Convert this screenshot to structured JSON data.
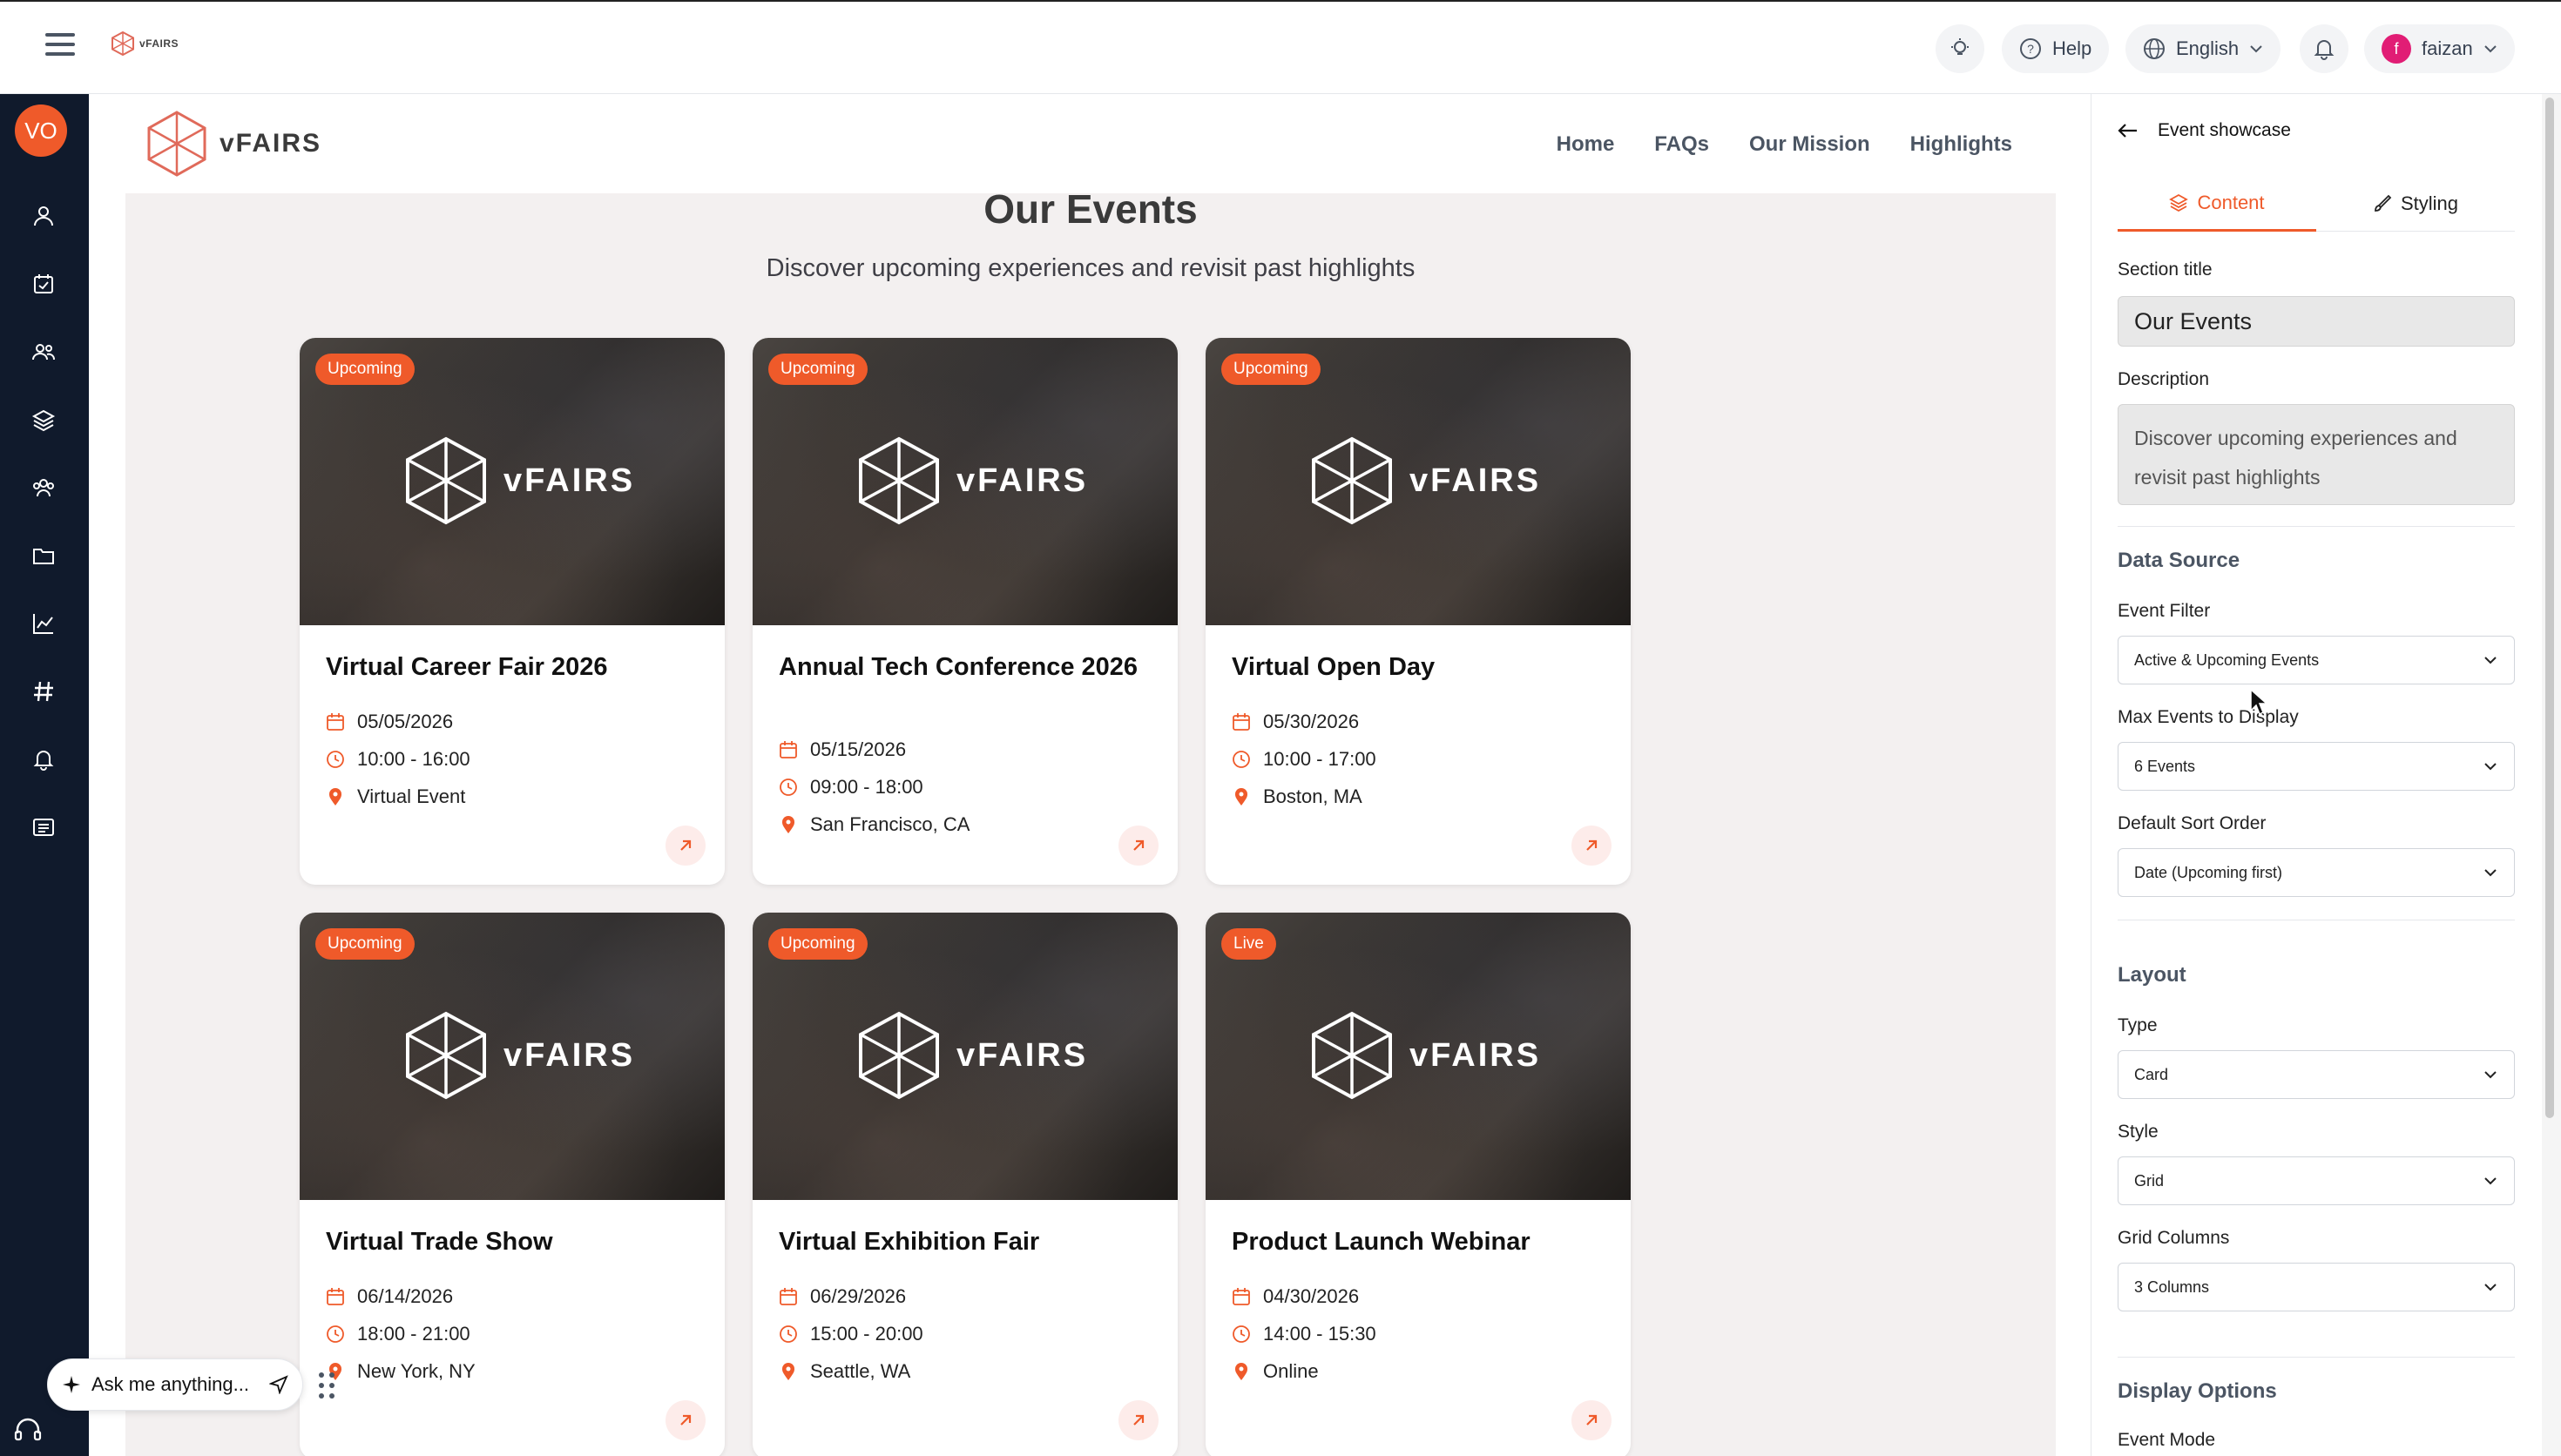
{
  "topbar": {
    "logo_text": "vFAIRS",
    "help_label": "Help",
    "language_label": "English",
    "user_initial": "f",
    "user_name": "faizan"
  },
  "rail": {
    "avatar_initials": "VO",
    "items": [
      "user-icon",
      "calendar-check-icon",
      "users-icon",
      "layers-icon",
      "team-icon",
      "folder-icon",
      "analytics-icon",
      "hashtag-icon",
      "bell-icon",
      "list-icon"
    ]
  },
  "site": {
    "logo_text": "vFAIRS",
    "nav": [
      "Home",
      "FAQs",
      "Our Mission",
      "Highlights"
    ]
  },
  "section": {
    "title": "Our Events",
    "description": "Discover upcoming experiences and revisit past highlights"
  },
  "events": [
    {
      "badge": "Upcoming",
      "brand": "vFAIRS",
      "title": "Virtual Career Fair 2026",
      "date": "05/05/2026",
      "time": "10:00 - 16:00",
      "location": "Virtual Event"
    },
    {
      "badge": "Upcoming",
      "brand": "vFAIRS",
      "title": "Annual Tech Conference 2026",
      "date": "05/15/2026",
      "time": "09:00 - 18:00",
      "location": "San Francisco, CA"
    },
    {
      "badge": "Upcoming",
      "brand": "vFAIRS",
      "title": "Virtual Open Day",
      "date": "05/30/2026",
      "time": "10:00 - 17:00",
      "location": "Boston, MA"
    },
    {
      "badge": "Upcoming",
      "brand": "vFAIRS",
      "title": "Virtual Trade Show",
      "date": "06/14/2026",
      "time": "18:00 - 21:00",
      "location": "New York, NY"
    },
    {
      "badge": "Upcoming",
      "brand": "vFAIRS",
      "title": "Virtual Exhibition Fair",
      "date": "06/29/2026",
      "time": "15:00 - 20:00",
      "location": "Seattle, WA"
    },
    {
      "badge": "Live",
      "brand": "vFAIRS",
      "title": "Product Launch Webinar",
      "date": "04/30/2026",
      "time": "14:00 - 15:30",
      "location": "Online"
    }
  ],
  "panel": {
    "header": "Event showcase",
    "tab_content": "Content",
    "tab_styling": "Styling",
    "section_title_label": "Section title",
    "section_title_value": "Our Events",
    "description_label": "Description",
    "description_value": "Discover upcoming experiences and revisit past highlights",
    "data_source_heading": "Data Source",
    "event_filter_label": "Event Filter",
    "event_filter_value": "Active & Upcoming Events",
    "max_events_label": "Max Events to Display",
    "max_events_value": "6 Events",
    "sort_label": "Default Sort Order",
    "sort_value": "Date (Upcoming first)",
    "layout_heading": "Layout",
    "type_label": "Type",
    "type_value": "Card",
    "style_label": "Style",
    "style_value": "Grid",
    "grid_label": "Grid Columns",
    "grid_value": "3 Columns",
    "display_heading": "Display Options",
    "event_mode_label": "Event Mode"
  },
  "ask": {
    "placeholder": "Ask me anything..."
  },
  "colors": {
    "accent": "#ef5a2a",
    "rail": "#101a2c"
  }
}
